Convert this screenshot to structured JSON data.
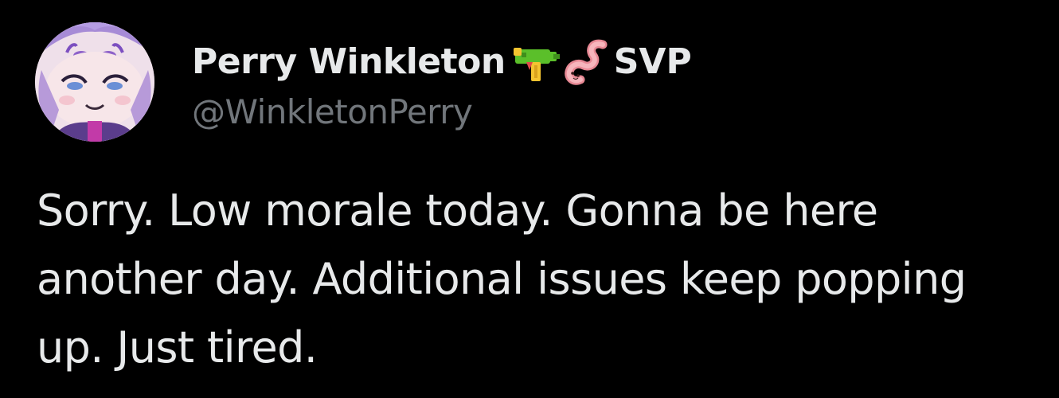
{
  "author": {
    "display_name": "Perry Winkleton",
    "name_emojis": [
      "water-gun-icon",
      "worm-icon"
    ],
    "name_suffix": "SVP",
    "handle": "@WinkletonPerry"
  },
  "tweet": {
    "text": "Sorry. Low morale today. Gonna be here another day. Additional issues keep popping up. Just tired."
  },
  "colors": {
    "background": "#000000",
    "primary_text": "#e7e9ea",
    "secondary_text": "#71767b",
    "water_gun_green": "#5bbf2a",
    "water_gun_yellow": "#f4c430",
    "worm_pink": "#f2a0a8"
  }
}
